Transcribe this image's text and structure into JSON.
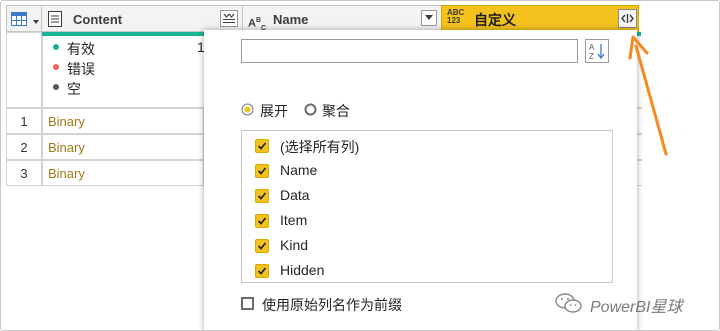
{
  "columns": {
    "content": {
      "label": "Content"
    },
    "name": {
      "label": "Name",
      "type_glyph_top": "A",
      "type_glyph_sup": "B",
      "type_glyph_sub": "C"
    },
    "custom": {
      "label": "自定义",
      "type_glyph_top": "ABC",
      "type_glyph_bottom": "123"
    }
  },
  "profile": {
    "valid_label": "有效",
    "valid_value": "1",
    "error_label": "错误",
    "empty_label": "空",
    "valid_color": "#1ab394",
    "error_color": "#f06460",
    "empty_color": "#555555"
  },
  "rows": [
    {
      "index": "1",
      "content": "Binary"
    },
    {
      "index": "2",
      "content": "Binary"
    },
    {
      "index": "3",
      "content": "Binary"
    }
  ],
  "popup": {
    "search": {
      "value": "",
      "placeholder": ""
    },
    "radio": {
      "expand": "展开",
      "aggregate": "聚合",
      "selected": "expand"
    },
    "items": [
      {
        "label": "(选择所有列)",
        "checked": true
      },
      {
        "label": "Name",
        "checked": true
      },
      {
        "label": "Data",
        "checked": true
      },
      {
        "label": "Item",
        "checked": true
      },
      {
        "label": "Kind",
        "checked": true
      },
      {
        "label": "Hidden",
        "checked": true
      }
    ],
    "prefix_label": "使用原始列名作为前缀",
    "prefix_checked": false
  },
  "watermark": "PowerBI星球",
  "colors": {
    "accent_yellow": "#f3c21c",
    "arrow_orange": "#f5891f",
    "teal": "#1ab394"
  }
}
